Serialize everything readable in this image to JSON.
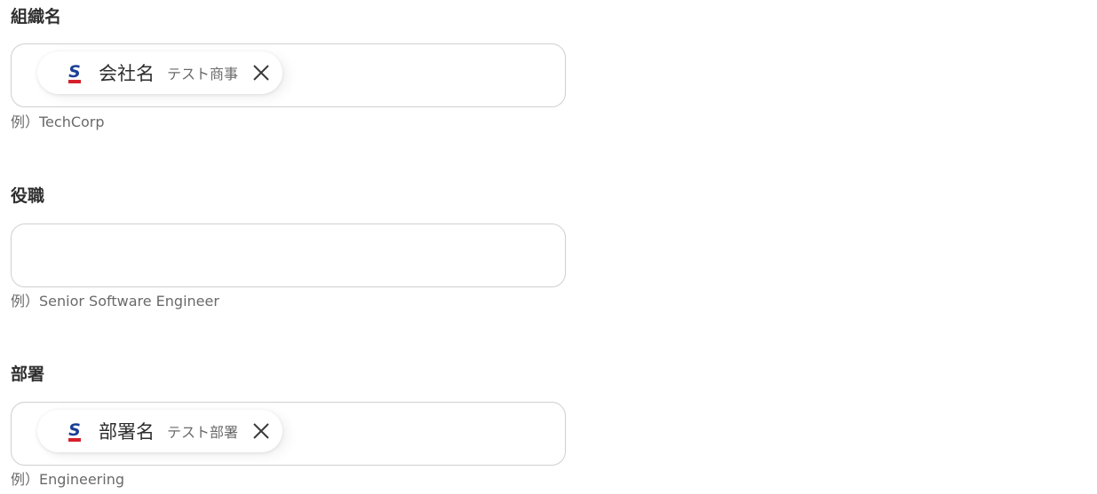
{
  "form": {
    "fields": [
      {
        "label": "組織名",
        "hint": "例）TechCorp",
        "chip": {
          "main": "会社名",
          "sub": "テスト商事",
          "icon": "salesforce-s-icon"
        }
      },
      {
        "label": "役職",
        "hint": "例）Senior Software Engineer",
        "chip": null
      },
      {
        "label": "部署",
        "hint": "例）Engineering",
        "chip": {
          "main": "部署名",
          "sub": "テスト部署",
          "icon": "salesforce-s-icon"
        }
      }
    ]
  },
  "colors": {
    "icon_blue": "#1b3f95",
    "icon_red": "#d6202b",
    "border": "#cfcfcf"
  }
}
